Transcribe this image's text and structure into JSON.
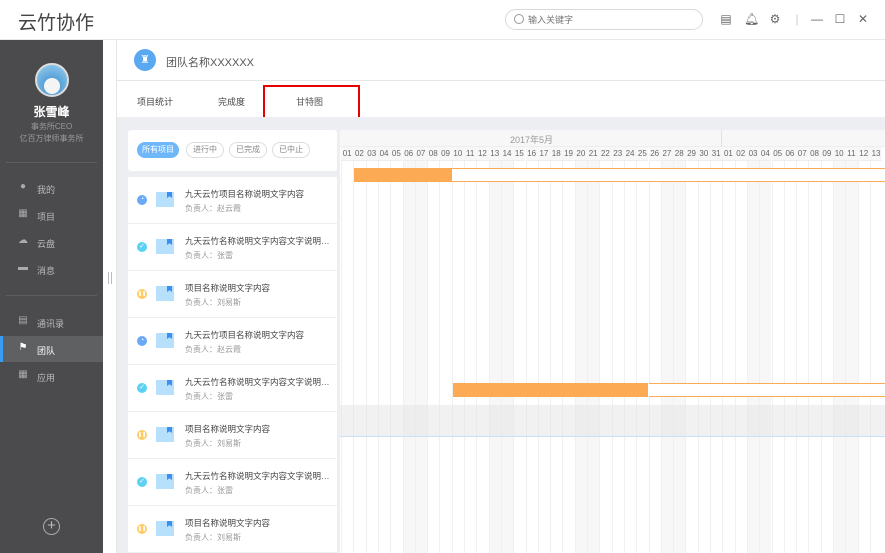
{
  "app": {
    "title": "云竹协作"
  },
  "search": {
    "placeholder": "输入关键字"
  },
  "toolbar": {
    "icons": [
      "clipboard-icon",
      "bell-icon",
      "gear-icon"
    ],
    "window": [
      "minimize-icon",
      "maximize-icon",
      "close-icon"
    ]
  },
  "user": {
    "name": "张雪峰",
    "role": "事务所CEO",
    "company": "亿百万律师事务所"
  },
  "sidebar": {
    "items": [
      {
        "label": "我的",
        "icon": "user-icon"
      },
      {
        "label": "项目",
        "icon": "project-icon"
      },
      {
        "label": "云盘",
        "icon": "cloud-icon"
      },
      {
        "label": "消息",
        "icon": "message-icon"
      },
      {
        "label": "通讯录",
        "icon": "contacts-icon"
      },
      {
        "label": "团队",
        "icon": "flag-icon",
        "active": true
      },
      {
        "label": "应用",
        "icon": "apps-icon"
      }
    ]
  },
  "header": {
    "team_name": "团队名称XXXXXX"
  },
  "tabs": [
    {
      "label": "项目统计"
    },
    {
      "label": "完成度"
    },
    {
      "label": "甘特图",
      "selected": true
    }
  ],
  "filters": [
    {
      "label": "所有项目",
      "active": true
    },
    {
      "label": "进行中"
    },
    {
      "label": "已完成"
    },
    {
      "label": "已中止"
    }
  ],
  "status_colors": {
    "in_progress": "#6aa9f5",
    "done": "#5ad1f5",
    "paused": "#ffcc66"
  },
  "projects": [
    {
      "title": "九天云竹项目名称说明文字内容",
      "owner": "负责人：赵云霞",
      "status": "in_progress"
    },
    {
      "title": "九天云竹名称说明文字内容文字说明文字",
      "owner": "负责人：张雷",
      "status": "done"
    },
    {
      "title": "项目名称说明文字内容",
      "owner": "负责人：刘易斯",
      "status": "paused"
    },
    {
      "title": "九天云竹项目名称说明文字内容",
      "owner": "负责人：赵云霞",
      "status": "in_progress"
    },
    {
      "title": "九天云竹名称说明文字内容文字说明文字",
      "owner": "负责人：张雷",
      "status": "done"
    },
    {
      "title": "项目名称说明文字内容",
      "owner": "负责人：刘易斯",
      "status": "paused"
    },
    {
      "title": "九天云竹名称说明文字内容文字说明文字",
      "owner": "负责人：张雷",
      "status": "done"
    },
    {
      "title": "项目名称说明文字内容",
      "owner": "负责人：刘易斯",
      "status": "paused"
    }
  ],
  "gantt": {
    "month_label": "2017年5月",
    "days": [
      "01",
      "02",
      "03",
      "04",
      "05",
      "06",
      "07",
      "08",
      "09",
      "10",
      "11",
      "12",
      "13",
      "14",
      "15",
      "16",
      "17",
      "18",
      "19",
      "20",
      "21",
      "22",
      "23",
      "24",
      "25",
      "26",
      "27",
      "28",
      "29",
      "30",
      "31",
      "01",
      "02",
      "03",
      "04",
      "05",
      "06",
      "07",
      "08",
      "09",
      "10",
      "11",
      "12",
      "13"
    ],
    "weekend_days": [
      "2017-05-06",
      "2017-05-07",
      "2017-05-13",
      "2017-05-14",
      "2017-05-20",
      "2017-05-21",
      "2017-05-27",
      "2017-05-28",
      "2017-06-03",
      "2017-06-04",
      "2017-06-10",
      "2017-06-11"
    ],
    "bar_color": "#fcab54",
    "bars": [
      {
        "row": 1,
        "start": "2017-05-02",
        "progress_end": "2017-05-09"
      },
      {
        "row": 5,
        "start": "2017-05-10",
        "progress_end": "2017-05-25"
      }
    ]
  }
}
